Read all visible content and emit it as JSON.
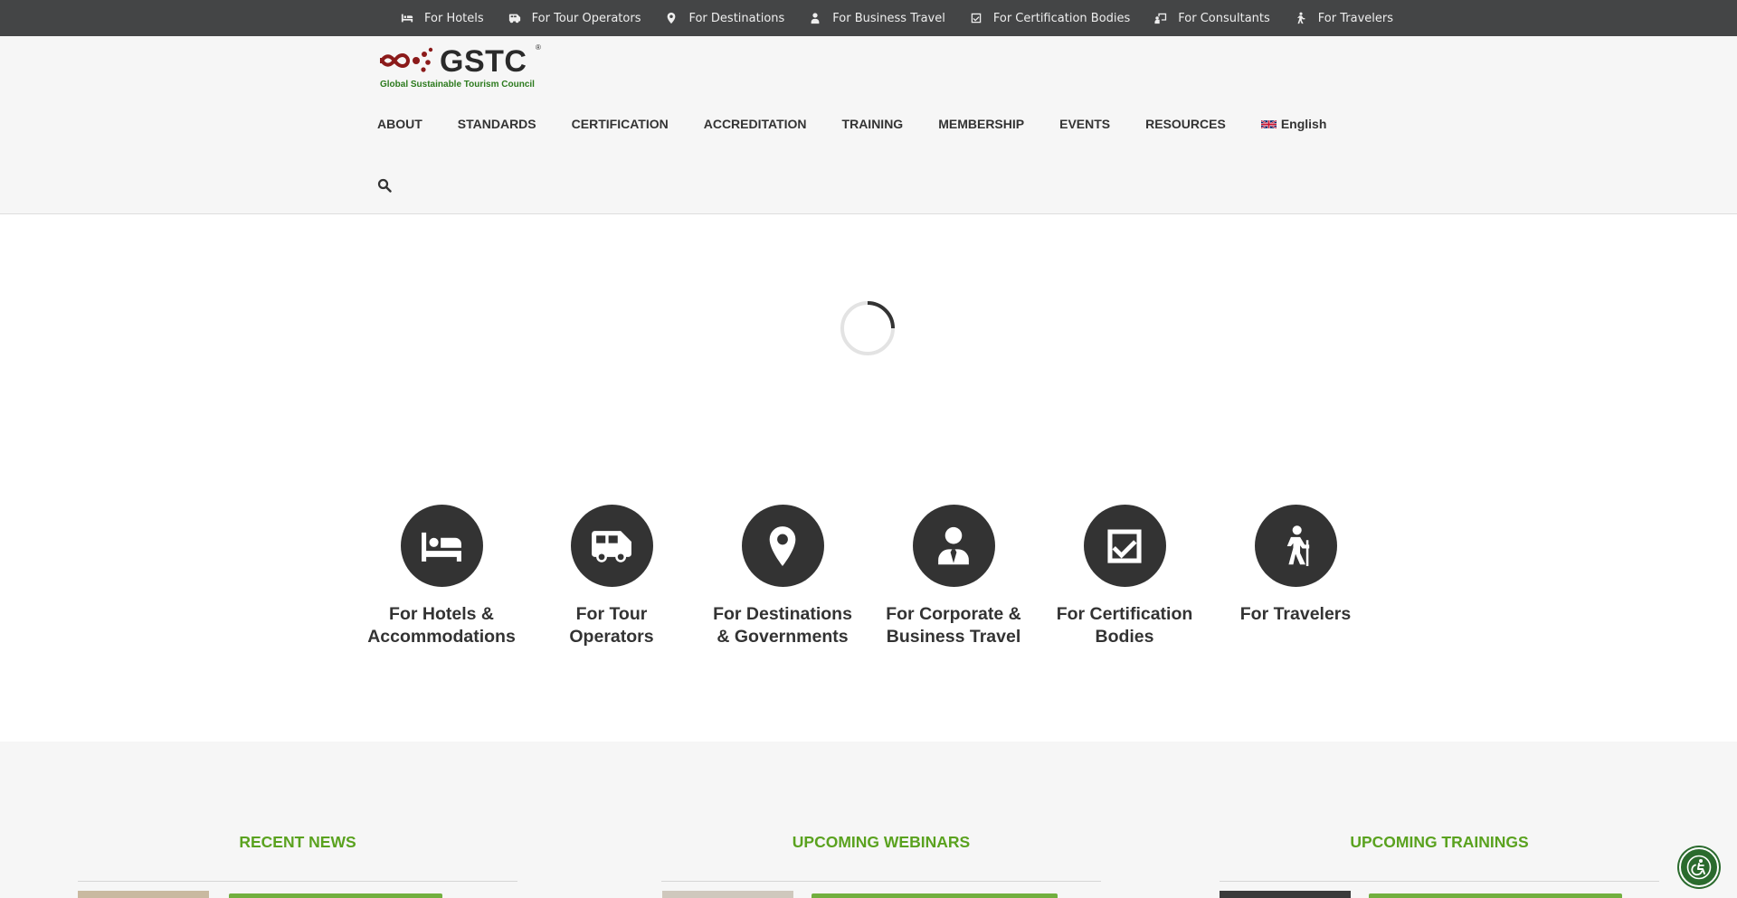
{
  "topbar": {
    "items": [
      {
        "label": "For Hotels",
        "icon": "bed-icon"
      },
      {
        "label": "For Tour Operators",
        "icon": "bus-icon"
      },
      {
        "label": "For Destinations",
        "icon": "map-marker-icon"
      },
      {
        "label": "For Business Travel",
        "icon": "user-tie-icon"
      },
      {
        "label": "For Certification Bodies",
        "icon": "check-square-icon"
      },
      {
        "label": "For Consultants",
        "icon": "chalkboard-teacher-icon"
      },
      {
        "label": "For Travelers",
        "icon": "hiking-icon"
      }
    ]
  },
  "logo": {
    "word": "GSTC",
    "reg": "®",
    "tagline": "Global Sustainable Tourism Council",
    "mark_color": "#8b1a1a"
  },
  "nav": {
    "items": [
      "ABOUT",
      "STANDARDS",
      "CERTIFICATION",
      "ACCREDITATION",
      "TRAINING",
      "MEMBERSHIP",
      "EVENTS",
      "RESOURCES"
    ],
    "language": "English",
    "search_icon": "search-icon"
  },
  "audiences": [
    {
      "line1": "For Hotels &",
      "line2": "Accommodations",
      "icon": "bed-icon"
    },
    {
      "line1": "For Tour",
      "line2": "Operators",
      "icon": "bus-icon"
    },
    {
      "line1": "For Destinations",
      "line2": "& Governments",
      "icon": "map-marker-icon"
    },
    {
      "line1": "For Corporate &",
      "line2": "Business Travel",
      "icon": "user-tie-icon"
    },
    {
      "line1": "For Certification",
      "line2": "Bodies",
      "icon": "check-square-icon"
    },
    {
      "line1": "For Travelers",
      "line2": "",
      "icon": "hiking-icon"
    }
  ],
  "sections": {
    "news": "RECENT NEWS",
    "webinars": "UPCOMING WEBINARS",
    "trainings": "UPCOMING TRAININGS"
  },
  "colors": {
    "topbar_bg": "#444546",
    "header_bg": "#f6f6f6",
    "accent_green": "#5aa21f",
    "icon_circle": "#333333",
    "a11y_button": "#2b6b2e"
  },
  "a11y": {
    "icon": "accessibility-icon"
  }
}
